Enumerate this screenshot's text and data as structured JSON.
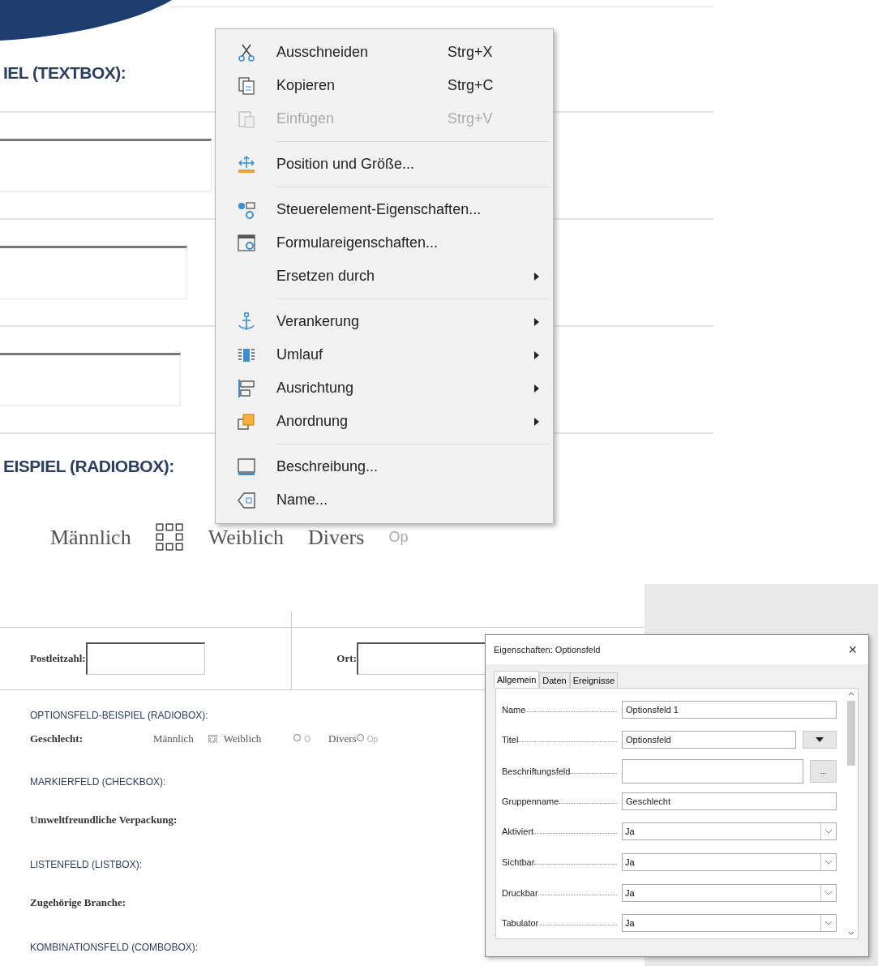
{
  "zoomed_document": {
    "heading_1": "IEL (TEXTBOX):",
    "heading_2": "EISPIEL (RADIOBOX):",
    "options": [
      {
        "label": "Männlich"
      },
      {
        "label": "Weiblich"
      },
      {
        "label": "Divers"
      }
    ],
    "trailing_label": "Op"
  },
  "context_menu": {
    "items": [
      {
        "kind": "item",
        "label": "Ausschneiden",
        "shortcut": "Strg+X",
        "disabled": false,
        "submenu": false
      },
      {
        "kind": "item",
        "label": "Kopieren",
        "shortcut": "Strg+C",
        "disabled": false,
        "submenu": false
      },
      {
        "kind": "item",
        "label": "Einfügen",
        "shortcut": "Strg+V",
        "disabled": true,
        "submenu": false
      },
      {
        "kind": "separator"
      },
      {
        "kind": "item",
        "label": "Position und Größe...",
        "disabled": false,
        "submenu": false
      },
      {
        "kind": "separator"
      },
      {
        "kind": "item",
        "label": "Steuerelement-Eigenschaften...",
        "disabled": false,
        "submenu": false
      },
      {
        "kind": "item",
        "label": "Formulareigenschaften...",
        "disabled": false,
        "submenu": false
      },
      {
        "kind": "item",
        "label": "Ersetzen durch",
        "disabled": false,
        "submenu": true
      },
      {
        "kind": "separator"
      },
      {
        "kind": "item",
        "label": "Verankerung",
        "disabled": false,
        "submenu": true
      },
      {
        "kind": "item",
        "label": "Umlauf",
        "disabled": false,
        "submenu": true
      },
      {
        "kind": "item",
        "label": "Ausrichtung",
        "disabled": false,
        "submenu": true
      },
      {
        "kind": "item",
        "label": "Anordnung",
        "disabled": false,
        "submenu": true
      },
      {
        "kind": "separator"
      },
      {
        "kind": "item",
        "label": "Beschreibung...",
        "disabled": false,
        "submenu": false
      },
      {
        "kind": "item",
        "label": "Name...",
        "disabled": false,
        "submenu": false
      }
    ]
  },
  "document": {
    "postal_label": "Postleitzahl:",
    "city_label": "Ort:",
    "radio_heading": "OPTIONSFELD-BEISPIEL (RADIOBOX):",
    "radio_label": "Geschlecht:",
    "radio_options": [
      {
        "label": "Männlich"
      },
      {
        "label": "Weiblich",
        "trailing_radio": {
          "checked": false,
          "hint": "O"
        }
      },
      {
        "label": "Divers",
        "trailing_radio": {
          "checked": false,
          "hint": "Op"
        }
      }
    ],
    "checkbox_heading": "MARKIERFELD (CHECKBOX):",
    "checkbox_label": "Umweltfreundliche Verpackung:",
    "listbox_heading": "LISTENFELD (LISTBOX):",
    "listbox_label": "Zugehörige Branche:",
    "combobox_heading": "KOMBINATIONSFELD (COMBOBOX):"
  },
  "dialog": {
    "title": "Eigenschaften: Optionsfeld",
    "close": "×",
    "tabs": [
      {
        "label": "Allgemein",
        "selected": true
      },
      {
        "label": "Daten",
        "selected": false
      },
      {
        "label": "Ereignisse",
        "selected": false
      }
    ],
    "rows": [
      {
        "kind": "text",
        "label": "Name",
        "value": "Optionsfeld 1"
      },
      {
        "kind": "text_menu",
        "label": "Titel",
        "value": "Optionsfeld"
      },
      {
        "kind": "text_browse",
        "label": "Beschriftungsfeld",
        "button": "..."
      },
      {
        "kind": "text",
        "label": "Gruppenname",
        "value": "Geschlecht"
      },
      {
        "kind": "select",
        "label": "Aktiviert",
        "value": "Ja"
      },
      {
        "kind": "select",
        "label": "Sichtbar",
        "value": "Ja"
      },
      {
        "kind": "select",
        "label": "Druckbar",
        "value": "Ja"
      },
      {
        "kind": "select",
        "label": "Tabulator",
        "value": "Ja"
      }
    ]
  }
}
